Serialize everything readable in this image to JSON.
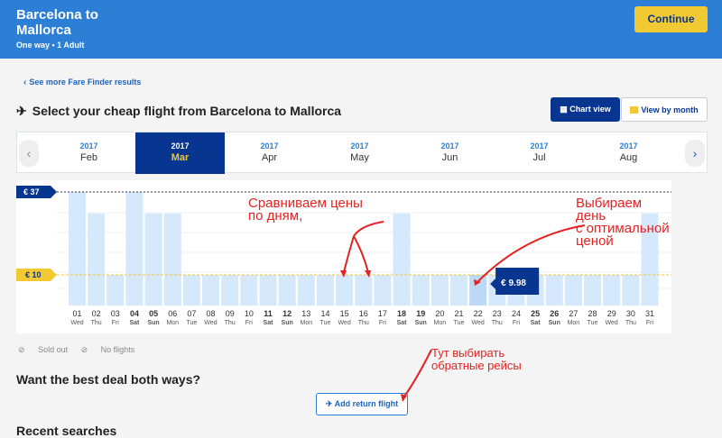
{
  "header": {
    "title": "Barcelona to Mallorca",
    "subtitle": "One way • 1 Adult",
    "continue_label": "Continue"
  },
  "nav": {
    "back_label": "See more Fare Finder results"
  },
  "section": {
    "title": "Select your cheap flight from Barcelona to Mallorca",
    "chart_view_label": "Chart view",
    "month_view_label": "View by month"
  },
  "months": [
    {
      "year": "2017",
      "name": "Feb"
    },
    {
      "year": "2017",
      "name": "Mar"
    },
    {
      "year": "2017",
      "name": "Apr"
    },
    {
      "year": "2017",
      "name": "May"
    },
    {
      "year": "2017",
      "name": "Jun"
    },
    {
      "year": "2017",
      "name": "Jul"
    },
    {
      "year": "2017",
      "name": "Aug"
    }
  ],
  "legend": {
    "sold_out": "Sold out",
    "no_flights": "No flights"
  },
  "return": {
    "question": "Want the best deal both ways?",
    "add_label": "Add return flight"
  },
  "recent": {
    "title": "Recent searches"
  },
  "annotations": {
    "a1_l1": "Сравниваем цены",
    "a1_l2": "по дням,",
    "a2_l1": "Выбираем",
    "a2_l2": "день",
    "a2_l3": "с оптимальной",
    "a2_l4": "ценой",
    "a3_l1": "Тут выбирать",
    "a3_l2": "обратные рейсы"
  },
  "colors": {
    "primary": "#073590",
    "accent": "#f1c933",
    "bar": "#d6e8fb",
    "selected_bar": "#bdd8f6"
  },
  "chart_data": {
    "type": "bar",
    "max_label": "€ 37",
    "min_label": "€ 10",
    "selected_label": "€ 9.98",
    "selected_index": 21,
    "ylim": [
      0,
      37
    ],
    "days": [
      "01",
      "02",
      "03",
      "04",
      "05",
      "06",
      "07",
      "08",
      "09",
      "10",
      "11",
      "12",
      "13",
      "14",
      "15",
      "16",
      "17",
      "18",
      "19",
      "20",
      "21",
      "22",
      "23",
      "24",
      "25",
      "26",
      "27",
      "28",
      "29",
      "30",
      "31"
    ],
    "weekdays": [
      "Wed",
      "Thu",
      "Fri",
      "Sat",
      "Sun",
      "Mon",
      "Tue",
      "Wed",
      "Thu",
      "Fri",
      "Sat",
      "Sun",
      "Mon",
      "Tue",
      "Wed",
      "Thu",
      "Fri",
      "Sat",
      "Sun",
      "Mon",
      "Tue",
      "Wed",
      "Thu",
      "Fri",
      "Sat",
      "Sun",
      "Mon",
      "Tue",
      "Wed",
      "Thu",
      "Fri"
    ],
    "bold_days": [
      3,
      4,
      10,
      11,
      17,
      18,
      24,
      25
    ],
    "values": [
      37,
      30,
      10,
      37,
      30,
      30,
      10,
      10,
      10,
      10,
      10,
      10,
      10,
      10,
      10,
      10,
      10,
      30,
      10,
      10,
      10,
      9.98,
      10,
      10,
      10,
      10,
      10,
      10,
      10,
      10,
      30
    ]
  }
}
